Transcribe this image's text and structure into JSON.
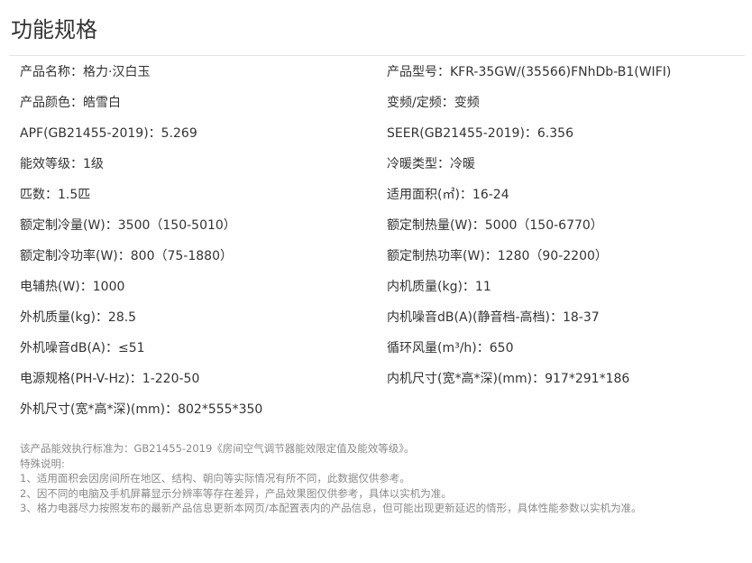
{
  "page": {
    "title": "功能规格"
  },
  "specs": [
    {
      "left": "产品名称：格力·汉白玉",
      "right": "产品型号：KFR-35GW/(35566)FNhDb-B1(WIFI)"
    },
    {
      "left": "产品颜色：皓雪白",
      "right": "变频/定频：变频"
    },
    {
      "left": "APF(GB21455-2019)：5.269",
      "right": "SEER(GB21455-2019)：6.356"
    },
    {
      "left": "能效等级：1级",
      "right": "冷暖类型：冷暖"
    },
    {
      "left": "匹数：1.5匹",
      "right": "适用面积(㎡)：16-24"
    },
    {
      "left": "额定制冷量(W)：3500（150-5010）",
      "right": "额定制热量(W)：5000（150-6770）"
    },
    {
      "left": "额定制冷功率(W)：800（75-1880）",
      "right": "额定制热功率(W)：1280（90-2200）"
    },
    {
      "left": "电辅热(W)：1000",
      "right": "内机质量(kg)：11"
    },
    {
      "left": "外机质量(kg)：28.5",
      "right": "内机噪音dB(A)(静音档-高档)：18-37"
    },
    {
      "left": "外机噪音dB(A)：≤51",
      "right": "循环风量(m³/h)：650"
    },
    {
      "left": "电源规格(PH-V-Hz)：1-220-50",
      "right": "内机尺寸(宽*高*深)(mm)：917*291*186"
    },
    {
      "left": "外机尺寸(宽*高*深)(mm)：802*555*350",
      "right": ""
    }
  ],
  "notes": [
    "该产品能效执行标准为：GB21455-2019《房间空气调节器能效限定值及能效等级》。",
    "特殊说明:",
    "1、适用面积会因房间所在地区、结构、朝向等实际情况有所不同，此数据仅供参考。",
    "2、因不同的电脑及手机屏幕显示分辨率等存在差异，产品效果图仅供参考，具体以实机为准。",
    "3、格力电器尽力按照发布的最新产品信息更新本网页/本配置表内的产品信息，但可能出现更新延迟的情形，具体性能参数以实机为准。"
  ]
}
